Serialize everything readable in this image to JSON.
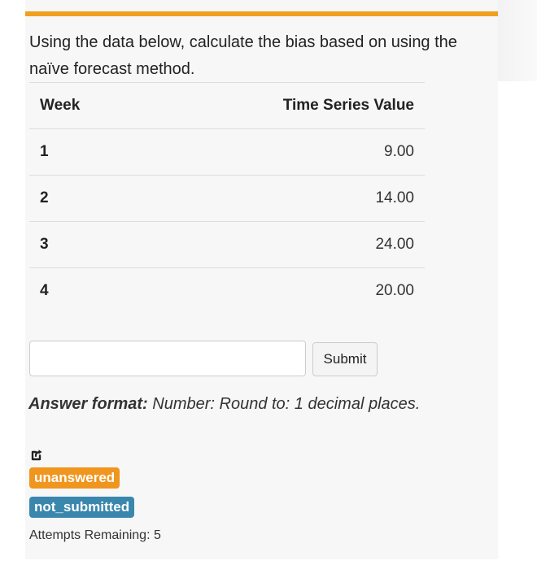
{
  "question": {
    "text": "Using the data below, calculate the bias based on using the naïve forecast method."
  },
  "table": {
    "headers": [
      "Week",
      "Time Series Value"
    ],
    "rows": [
      [
        "1",
        "9.00"
      ],
      [
        "2",
        "14.00"
      ],
      [
        "3",
        "24.00"
      ],
      [
        "4",
        "20.00"
      ]
    ]
  },
  "answer": {
    "value": "",
    "placeholder": "",
    "submit_label": "Submit"
  },
  "format": {
    "label": "Answer format:",
    "text": "Number: Round to: 1 decimal places."
  },
  "icons": {
    "share": "share-icon"
  },
  "status": {
    "answer_badge": "unanswered",
    "submission_badge": "not_submitted"
  },
  "attempts": {
    "text": "Attempts Remaining: 5"
  },
  "colors": {
    "accent_bar": "#f0a020",
    "badge_unanswered": "#f0951e",
    "badge_not_submitted": "#3a87ad"
  }
}
